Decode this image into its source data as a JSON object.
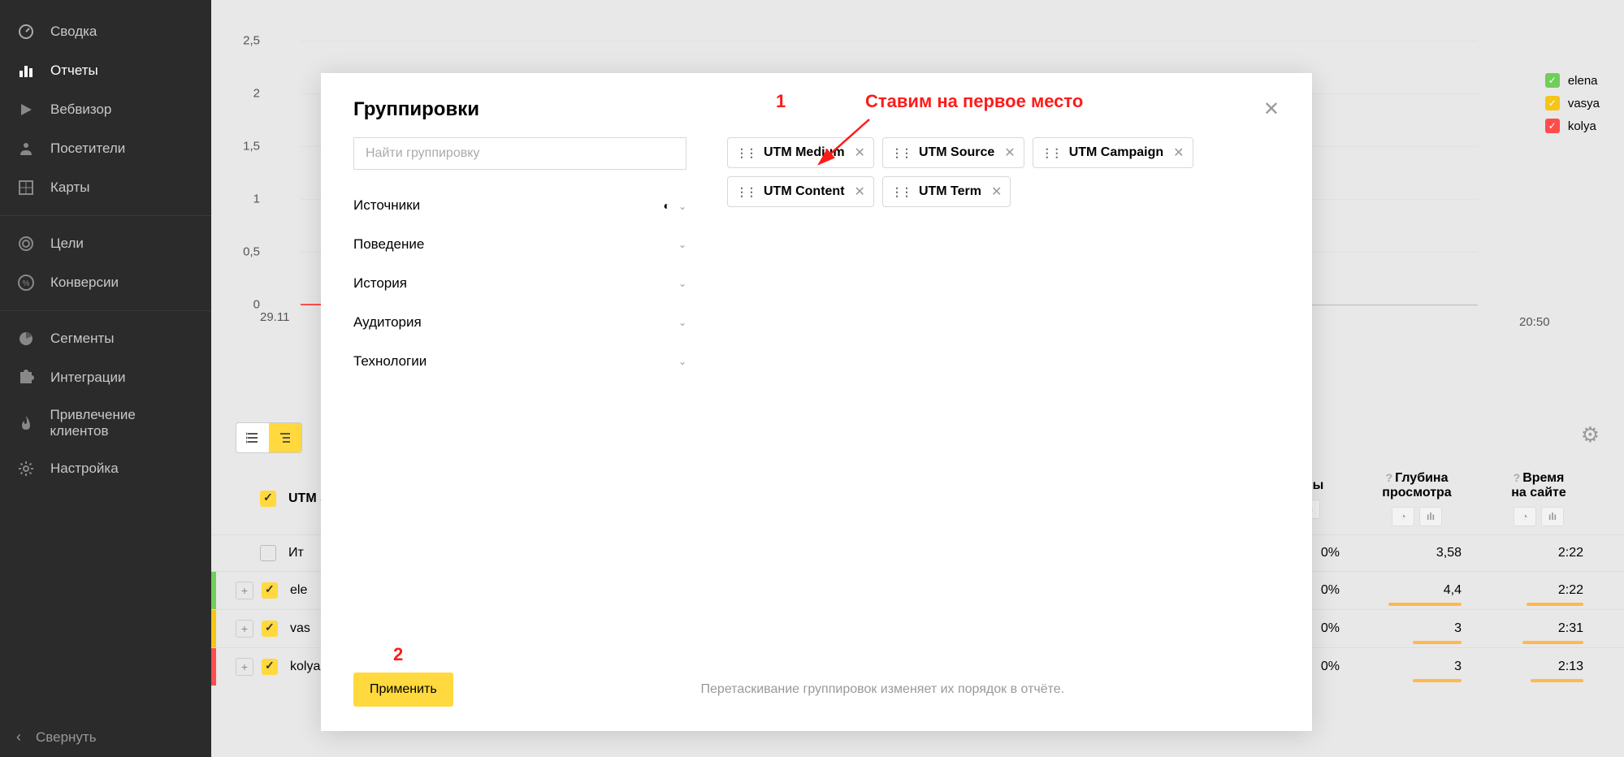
{
  "sidebar": {
    "items": [
      {
        "label": "Сводка",
        "icon": "dashboard"
      },
      {
        "label": "Отчеты",
        "icon": "bar-chart",
        "active": true
      },
      {
        "label": "Вебвизор",
        "icon": "play"
      },
      {
        "label": "Посетители",
        "icon": "user"
      },
      {
        "label": "Карты",
        "icon": "grid"
      }
    ],
    "items2": [
      {
        "label": "Цели",
        "icon": "target"
      },
      {
        "label": "Конверсии",
        "icon": "percent"
      }
    ],
    "items3": [
      {
        "label": "Сегменты",
        "icon": "pie"
      },
      {
        "label": "Интеграции",
        "icon": "puzzle"
      },
      {
        "label": "Привлечение клиентов",
        "icon": "flame"
      },
      {
        "label": "Настройка",
        "icon": "gear"
      }
    ],
    "collapse": "Свернуть"
  },
  "chart_data": {
    "type": "line",
    "y_ticks": [
      "2,5",
      "2",
      "1,5",
      "1",
      "0,5",
      "0"
    ],
    "x_start": "29.11",
    "x_label": "20:50",
    "series": [
      {
        "name": "elena",
        "color": "#6fcf5a"
      },
      {
        "name": "vasya",
        "color": "#f5c518"
      },
      {
        "name": "kolya",
        "color": "#ff4d4d"
      }
    ]
  },
  "table": {
    "first_col_label": "UTM So",
    "headers": [
      {
        "label": "Отказы"
      },
      {
        "label": "Глубина",
        "sub": "просмотра"
      },
      {
        "label": "Время",
        "sub": "на сайте"
      }
    ],
    "rows": [
      {
        "label": "Ит",
        "bounces": "0%",
        "depth": "3,58",
        "time": "2:22",
        "total": true
      },
      {
        "label": "ele",
        "bounces": "0%",
        "depth": "4,4",
        "time": "2:22",
        "color": "#6fcf5a"
      },
      {
        "label": "vas",
        "bounces": "0%",
        "depth": "3",
        "time": "2:31",
        "color": "#f5c518"
      },
      {
        "label": "kolya",
        "bounces": "0%",
        "depth": "3",
        "time": "2:13",
        "color": "#ff4d4d",
        "extra1": "3",
        "extra2": "3",
        "extra3": "0%"
      }
    ]
  },
  "modal": {
    "title": "Группировки",
    "search_placeholder": "Найти группировку",
    "categories": [
      {
        "label": "Источники",
        "half": true
      },
      {
        "label": "Поведение"
      },
      {
        "label": "История"
      },
      {
        "label": "Аудитория"
      },
      {
        "label": "Технологии"
      }
    ],
    "tags": [
      {
        "label": "UTM Medium"
      },
      {
        "label": "UTM Source"
      },
      {
        "label": "UTM Campaign"
      },
      {
        "label": "UTM Content"
      },
      {
        "label": "UTM Term"
      }
    ],
    "apply": "Применить",
    "hint": "Перетаскивание группировок изменяет их порядок в отчёте."
  },
  "annotations": {
    "num1": "1",
    "text1": "Ставим на первое место",
    "num2": "2"
  }
}
